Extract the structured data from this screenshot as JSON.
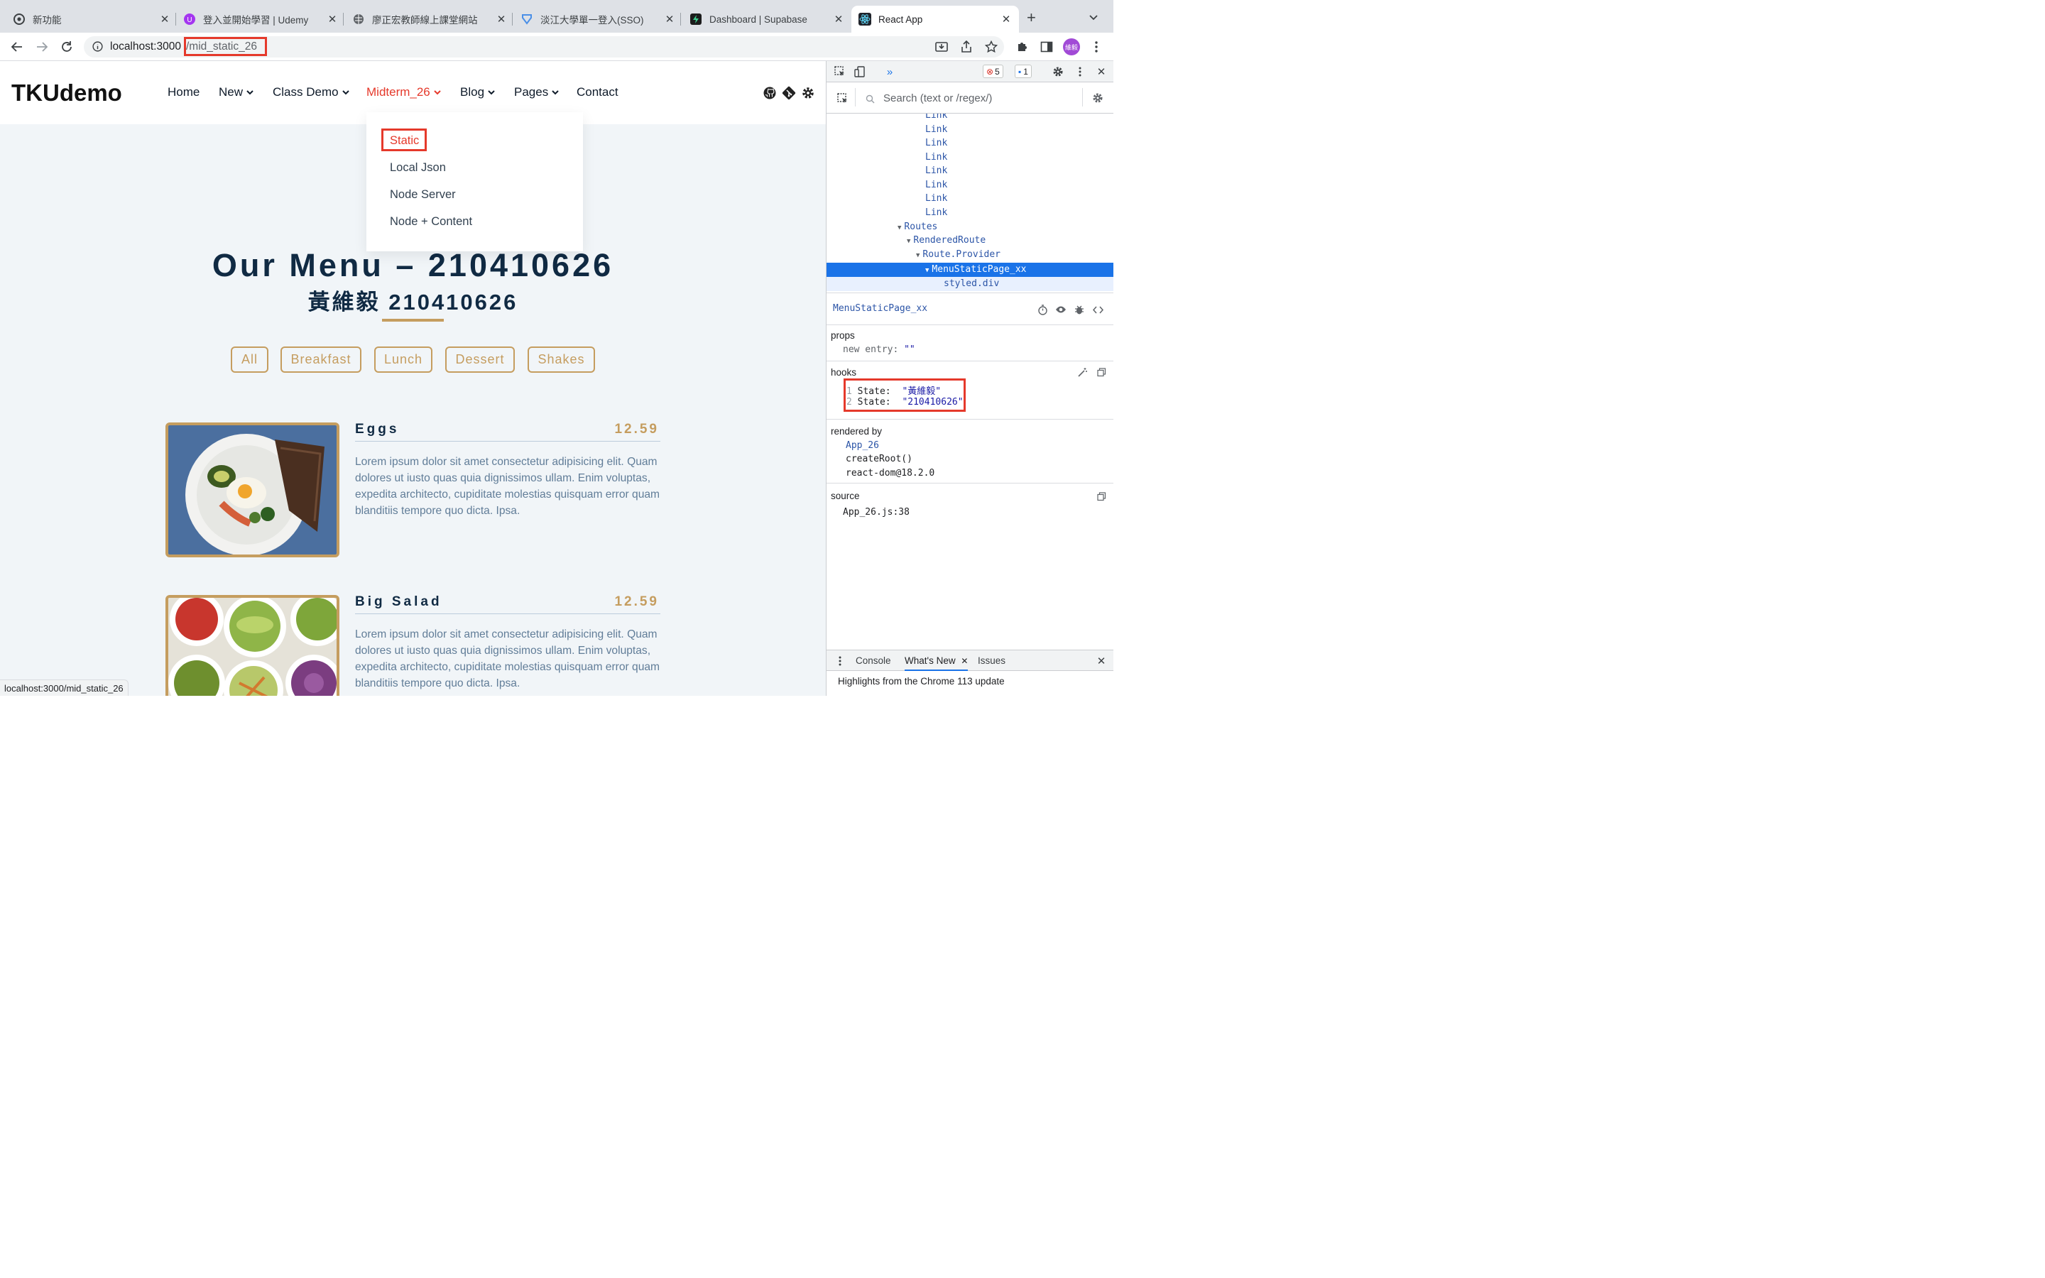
{
  "browser": {
    "tabs": [
      {
        "title": "新功能",
        "icon": "chrome-icon"
      },
      {
        "title": "登入並開始學習 | Udemy",
        "icon": "udemy-icon"
      },
      {
        "title": "廖正宏教師線上課堂網站",
        "icon": "globe-icon"
      },
      {
        "title": "淡江大學單一登入(SSO)",
        "icon": "tku-icon"
      },
      {
        "title": "Dashboard | Supabase",
        "icon": "supabase-icon"
      },
      {
        "title": "React App",
        "icon": "react-icon",
        "active": true
      }
    ],
    "url_host": "localhost:3000",
    "url_path": "/mid_static_26",
    "avatar_text": "維毅",
    "status_url": "localhost:3000/mid_static_26"
  },
  "site": {
    "brand": "TKUdemo",
    "nav": [
      {
        "label": "Home"
      },
      {
        "label": "New",
        "dropdown": true
      },
      {
        "label": "Class Demo",
        "dropdown": true
      },
      {
        "label": "Midterm_26",
        "dropdown": true,
        "active": true
      },
      {
        "label": "Blog",
        "dropdown": true
      },
      {
        "label": "Pages",
        "dropdown": true
      },
      {
        "label": "Contact"
      }
    ],
    "social_icons": [
      "github-icon",
      "git-icon",
      "gear-icon"
    ],
    "dropdown_items": [
      "Static",
      "Local Json",
      "Node Server",
      "Node + Content"
    ],
    "title": "Our Menu – 210410626",
    "subtitle": "黃維毅 210410626",
    "filters": [
      "All",
      "Breakfast",
      "Lunch",
      "Dessert",
      "Shakes"
    ],
    "items": [
      {
        "name": "Eggs",
        "price": "12.59",
        "desc": "Lorem ipsum dolor sit amet consectetur adipisicing elit. Quam dolores ut iusto quas quia dignissimos ullam. Enim voluptas, expedita architecto, cupiditate molestias quisquam error quam blanditiis tempore quo dicta. Ipsa."
      },
      {
        "name": "Big Salad",
        "price": "12.59",
        "desc": "Lorem ipsum dolor sit amet consectetur adipisicing elit. Quam dolores ut iusto quas quia dignissimos ullam. Enim voluptas, expedita architecto, cupiditate molestias quisquam error quam blanditiis tempore quo dicta. Ipsa."
      }
    ],
    "colors": {
      "accent": "#c59d5f",
      "active": "#e5392b",
      "heading": "#102a43",
      "body_bg": "#f1f5f8"
    }
  },
  "devtools": {
    "errors": "5",
    "messages": "1",
    "search_placeholder": "Search (text or /regex/)",
    "tree": [
      {
        "label": "Link"
      },
      {
        "label": "Link"
      },
      {
        "label": "Link"
      },
      {
        "label": "Link"
      },
      {
        "label": "Link"
      },
      {
        "label": "Link"
      },
      {
        "label": "Link"
      },
      {
        "label": "Link"
      },
      {
        "label": "Routes"
      },
      {
        "label": "RenderedRoute"
      },
      {
        "label": "Route.Provider"
      },
      {
        "label": "MenuStaticPage_xx",
        "selected": true
      },
      {
        "label": "styled.div"
      }
    ],
    "component": "MenuStaticPage_xx",
    "props_label": "props",
    "props": [
      {
        "key": "new entry",
        "value": "\"\""
      }
    ],
    "hooks_label": "hooks",
    "hooks": [
      {
        "index": "1",
        "key": "State:",
        "value": "\"黃維毅\""
      },
      {
        "index": "2",
        "key": "State:",
        "value": "\"210410626\""
      }
    ],
    "rendered_by_label": "rendered by",
    "rendered_by": [
      "App_26",
      "createRoot()",
      "react-dom@18.2.0"
    ],
    "source_label": "source",
    "source": "App_26.js:38",
    "bottom_tabs": [
      "Console",
      "What's New",
      "Issues"
    ],
    "message": "Highlights from the Chrome 113 update"
  }
}
